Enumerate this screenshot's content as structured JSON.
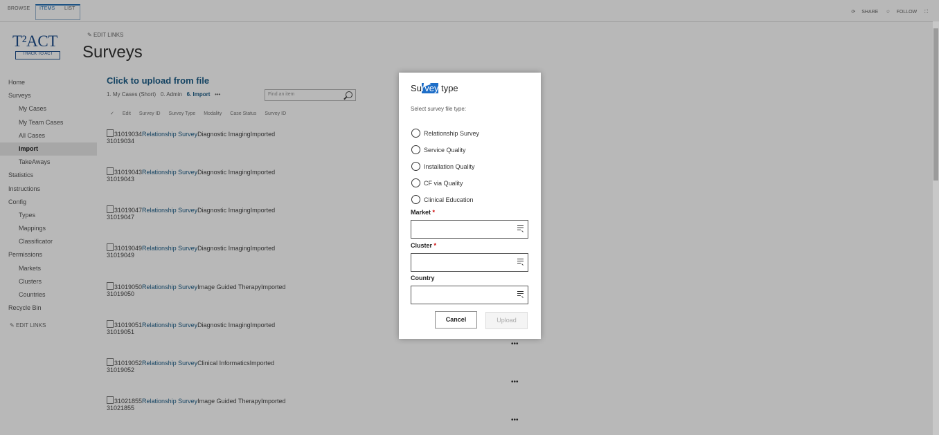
{
  "topbar": {
    "tabs": [
      "BROWSE",
      "ITEMS",
      "LIST"
    ],
    "actions": [
      "SHARE",
      "FOLLOW"
    ]
  },
  "logo": {
    "main": "T²ACT",
    "sub": "TRACK TO ACT"
  },
  "edit_links_top": "EDIT LINKS",
  "page_title": "Surveys",
  "nav": [
    {
      "label": "Home",
      "level": 1
    },
    {
      "label": "Surveys",
      "level": 1
    },
    {
      "label": "My Cases",
      "level": 2
    },
    {
      "label": "My Team Cases",
      "level": 2
    },
    {
      "label": "All Cases",
      "level": 2
    },
    {
      "label": "Import",
      "level": 2,
      "active": true
    },
    {
      "label": "TakeAways",
      "level": 2
    },
    {
      "label": "Statistics",
      "level": 1
    },
    {
      "label": "Instructions",
      "level": 1
    },
    {
      "label": "Config",
      "level": 1
    },
    {
      "label": "Types",
      "level": 2
    },
    {
      "label": "Mappings",
      "level": 2
    },
    {
      "label": "Classificator",
      "level": 2
    },
    {
      "label": "Permissions",
      "level": 1
    },
    {
      "label": "Markets",
      "level": 2
    },
    {
      "label": "Clusters",
      "level": 2
    },
    {
      "label": "Countries",
      "level": 2
    },
    {
      "label": "Recycle Bin",
      "level": 1
    }
  ],
  "nav_edit_links": "EDIT LINKS",
  "main": {
    "upload_link": "Click to upload from file",
    "views": [
      "1. My Cases (Short)",
      "0. Admin",
      "6. Import",
      "•••"
    ],
    "search_placeholder": "Find an item",
    "columns": [
      "Edit",
      "Survey ID",
      "Survey Type",
      "Modality",
      "Case Status",
      "Survey ID"
    ]
  },
  "rows": [
    {
      "id": "31019034",
      "type": "Relationship Survey",
      "modality": "Diagnostic Imaging",
      "status": "Imported"
    },
    {
      "id": "31019043",
      "type": "Relationship Survey",
      "modality": "Diagnostic Imaging",
      "status": "Imported"
    },
    {
      "id": "31019047",
      "type": "Relationship Survey",
      "modality": "Diagnostic Imaging",
      "status": "Imported"
    },
    {
      "id": "31019049",
      "type": "Relationship Survey",
      "modality": "Diagnostic Imaging",
      "status": "Imported"
    },
    {
      "id": "31019050",
      "type": "Relationship Survey",
      "modality": "Image Guided Therapy",
      "status": "Imported"
    },
    {
      "id": "31019051",
      "type": "Relationship Survey",
      "modality": "Diagnostic Imaging",
      "status": "Imported"
    },
    {
      "id": "31019052",
      "type": "Relationship Survey",
      "modality": "Clinical Informatics",
      "status": "Imported"
    },
    {
      "id": "31021855",
      "type": "Relationship Survey",
      "modality": "Image Guided Therapy",
      "status": "Imported"
    }
  ],
  "row_menu": "•••",
  "dialog": {
    "title_parts": [
      "Su",
      "rvey",
      " type"
    ],
    "subtitle": "Select survey file type:",
    "options": [
      "Relationship Survey",
      "Service Quality",
      "Installation Quality",
      "CF via Quality",
      "Clinical Education"
    ],
    "fields": [
      {
        "label": "Market",
        "required": true
      },
      {
        "label": "Cluster",
        "required": true
      },
      {
        "label": "Country",
        "required": false
      }
    ],
    "required_mark": "*",
    "cancel_label": "Cancel",
    "upload_label": "Upload"
  }
}
